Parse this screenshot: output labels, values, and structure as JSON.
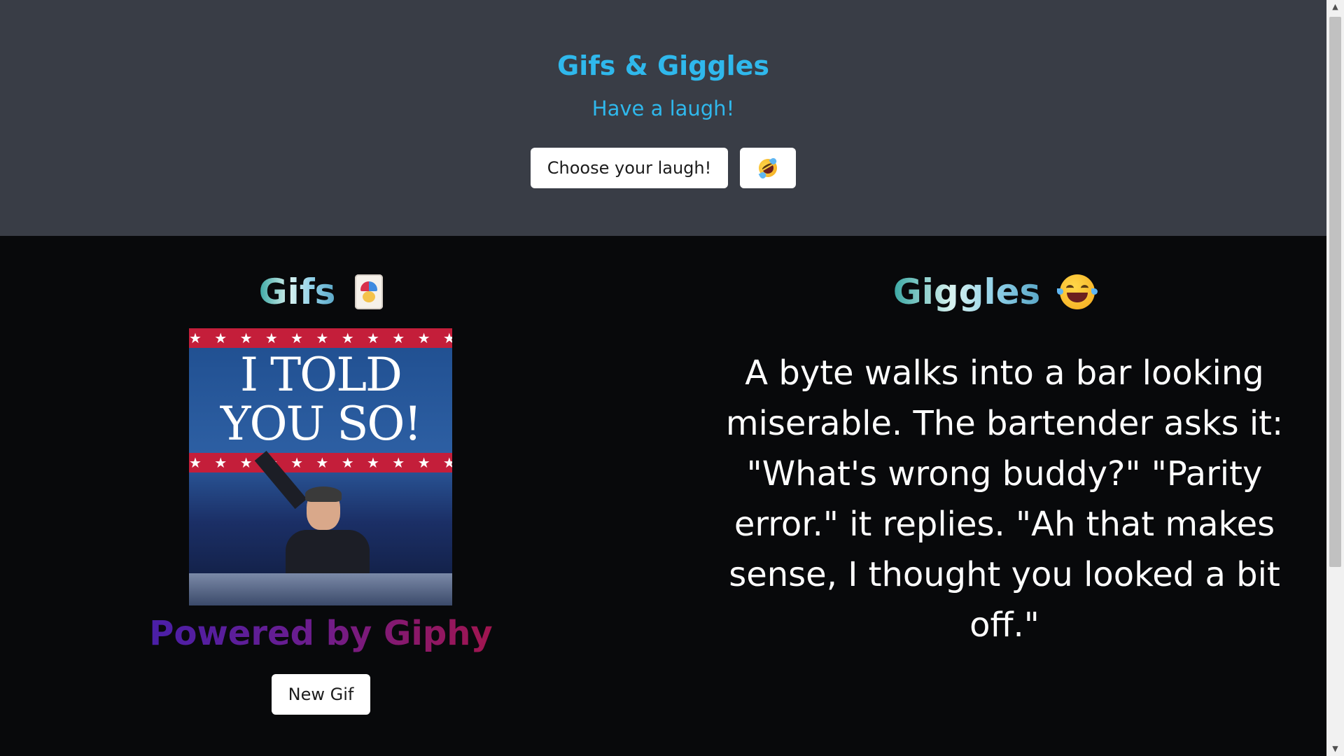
{
  "header": {
    "title": "Gifs & Giggles",
    "subtitle": "Have a laugh!",
    "choose_button_label": "Choose your laugh!",
    "emoji_button_icon": "rolling-on-floor-laughing-icon"
  },
  "gifs": {
    "heading": "Gifs",
    "heading_icon": "jester-card-icon",
    "gif_image": {
      "caption_text": "I TOLD YOU SO!",
      "stars": "★ ★ ★ ★ ★ ★ ★ ★ ★ ★ ★ ★ ★ ★"
    },
    "powered_by": "Powered by Giphy",
    "new_gif_button_label": "New Gif"
  },
  "giggles": {
    "heading": "Giggles",
    "heading_icon": "face-with-tears-of-joy-icon",
    "joke": "A byte walks into a bar looking miserable. The bartender asks it: \"What's wrong buddy?\" \"Parity error.\" it replies. \"Ah that makes sense, I thought you looked a bit off.\""
  },
  "colors": {
    "header_bg": "#393d46",
    "main_bg": "#08090b",
    "accent": "#2fb8ec"
  }
}
